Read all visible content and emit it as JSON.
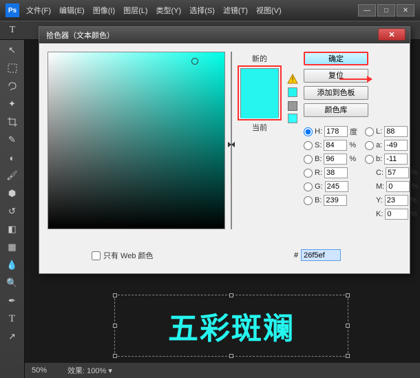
{
  "app": {
    "logo": "Ps"
  },
  "menu": {
    "file": "文件(F)",
    "edit": "编辑(E)",
    "image": "图像(I)",
    "layer": "图层(L)",
    "type": "类型(Y)",
    "select": "选择(S)",
    "filter": "滤镜(T)",
    "view": "视图(V)"
  },
  "winbtns": {
    "min": "—",
    "max": "□",
    "close": "✕"
  },
  "dialog": {
    "title": "拾色器（文本颜色）",
    "close": "✕",
    "new_label": "新的",
    "current_label": "当前",
    "ok": "确定",
    "reset": "复位",
    "add_swatch": "添加到色板",
    "color_lib": "颜色库",
    "web_only": "只有 Web 颜色",
    "hex_prefix": "#",
    "hex": "26f5ef"
  },
  "fields": {
    "H": {
      "v": "178",
      "u": "度"
    },
    "S": {
      "v": "84",
      "u": "%"
    },
    "B": {
      "v": "96",
      "u": "%"
    },
    "L": {
      "v": "88"
    },
    "a": {
      "v": "-49"
    },
    "b_lab": {
      "v": "-11"
    },
    "R": {
      "v": "38"
    },
    "G": {
      "v": "245"
    },
    "Bl": {
      "v": "239"
    },
    "C": {
      "v": "57",
      "u": "%"
    },
    "M": {
      "v": "0",
      "u": "%"
    },
    "Y": {
      "v": "23",
      "u": "%"
    },
    "K": {
      "v": "0",
      "u": "%"
    }
  },
  "canvas": {
    "text": "五彩斑斓"
  },
  "status": {
    "zoom": "50%",
    "fx_label": "效果:",
    "fx_value": "100%"
  }
}
